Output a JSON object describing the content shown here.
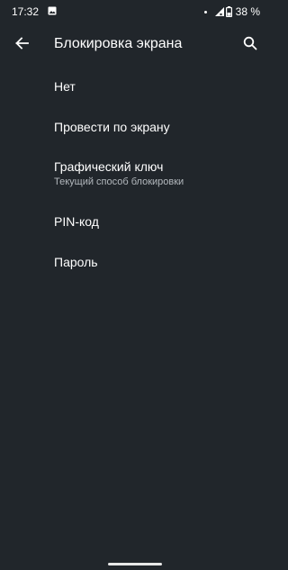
{
  "status_bar": {
    "time": "17:32",
    "battery_percent": "38 %",
    "icons": [
      "image-icon",
      "notification-dot-icon",
      "signal-icon",
      "battery-icon"
    ]
  },
  "app_bar": {
    "title": "Блокировка экрана",
    "back_icon": "arrow-left-icon",
    "search_icon": "search-icon"
  },
  "options": [
    {
      "label": "Нет",
      "summary": ""
    },
    {
      "label": "Провести по экрану",
      "summary": ""
    },
    {
      "label": "Графический ключ",
      "summary": "Текущий способ блокировки"
    },
    {
      "label": "PIN-код",
      "summary": ""
    },
    {
      "label": "Пароль",
      "summary": ""
    }
  ],
  "colors": {
    "background": "#21262b",
    "primary_text": "#ffffff",
    "secondary_text": "#b3b8bd"
  }
}
